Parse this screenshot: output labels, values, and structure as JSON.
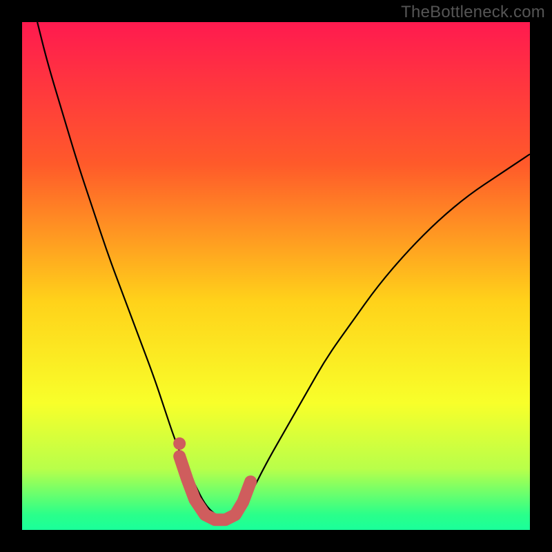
{
  "watermark": "TheBottleneck.com",
  "colors": {
    "frame": "#000000",
    "gradient_stops": [
      {
        "offset": 0.0,
        "color": "#ff1a4f"
      },
      {
        "offset": 0.28,
        "color": "#ff5a2a"
      },
      {
        "offset": 0.55,
        "color": "#ffd21a"
      },
      {
        "offset": 0.75,
        "color": "#f8ff2a"
      },
      {
        "offset": 0.88,
        "color": "#b8ff4a"
      },
      {
        "offset": 0.97,
        "color": "#2aff8a"
      },
      {
        "offset": 1.0,
        "color": "#1aff9a"
      }
    ],
    "curve": "#000000",
    "marker_fill": "#cf5d5d",
    "marker_stroke": "#cf5d5d"
  },
  "chart_data": {
    "type": "line",
    "title": "",
    "xlabel": "",
    "ylabel": "",
    "xlim": [
      0,
      100
    ],
    "ylim": [
      0,
      100
    ],
    "series": [
      {
        "name": "bottleneck-curve",
        "x": [
          3,
          5,
          8,
          11,
          14,
          17,
          20,
          23,
          26,
          28,
          30,
          32,
          34,
          36,
          38,
          40,
          42,
          45,
          48,
          52,
          56,
          60,
          65,
          70,
          76,
          82,
          88,
          94,
          100
        ],
        "y": [
          100,
          92,
          82,
          72,
          63,
          54,
          46,
          38,
          30,
          24,
          18,
          13,
          9,
          5,
          3,
          2,
          3,
          7,
          13,
          20,
          27,
          34,
          41,
          48,
          55,
          61,
          66,
          70,
          74
        ]
      }
    ],
    "annotations": {
      "marker_path_xy": [
        [
          31.0,
          14.5
        ],
        [
          32.5,
          10.0
        ],
        [
          34.0,
          6.0
        ],
        [
          36.0,
          3.0
        ],
        [
          38.0,
          2.0
        ],
        [
          40.0,
          2.0
        ],
        [
          42.0,
          3.0
        ],
        [
          43.5,
          5.5
        ],
        [
          45.0,
          9.5
        ]
      ],
      "marker_dot_xy": [
        31.0,
        17.0
      ]
    }
  }
}
